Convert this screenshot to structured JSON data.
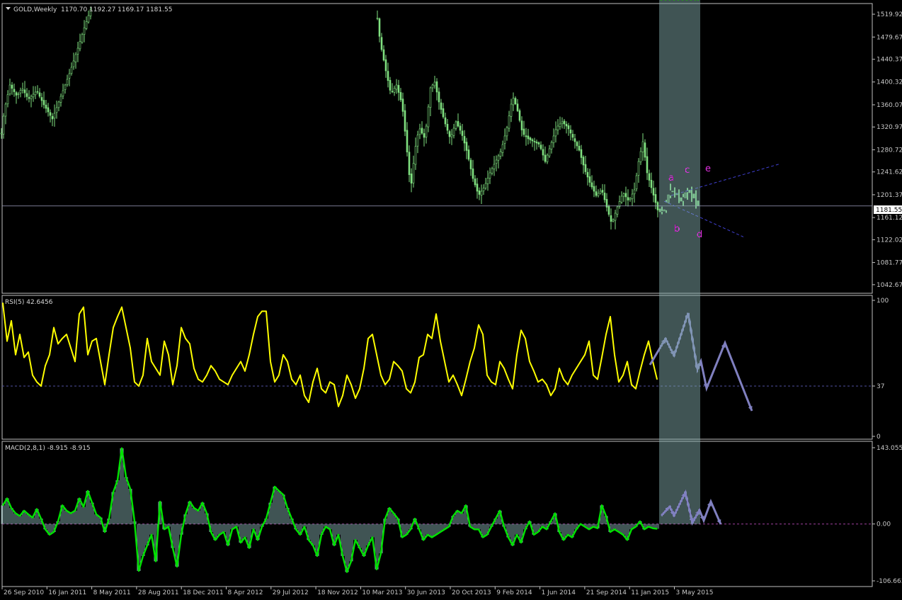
{
  "main_header": {
    "symbol": "GOLD,Weekly",
    "ohlc": "1170.70 1192.27 1169.17 1181.55"
  },
  "rsi_header": "RSI(5) 42.6456",
  "macd_header": "MACD(2,8,1) -8.915 -8.915",
  "current_price_tag": "1181.55",
  "wave_labels": [
    "a",
    "b",
    "c",
    "d",
    "e"
  ],
  "colors": {
    "background": "#000000",
    "frame": "#c0c0c0",
    "candle": "#7fe07f",
    "rsi_line": "#ffff00",
    "macd_line": "#00e000",
    "macd_hist": "#7fa7a7",
    "projection_arrows": "#8080c0",
    "trendline": "#4040d0",
    "wave_label": "#e030e0",
    "level_line": "#5050a0"
  },
  "chart_data": [
    {
      "type": "candlestick",
      "title": "GOLD,Weekly",
      "ylim": [
        1030,
        1535
      ],
      "y_ticks": [
        "1519.92",
        "1479.67",
        "1440.37",
        "1400.32",
        "1360.07",
        "1320.97",
        "1280.72",
        "1241.62",
        "1201.37",
        "1161.12",
        "1122.02",
        "1081.77",
        "1042.67"
      ],
      "x_ticks": [
        "26 Sep 2010",
        "16 Jan 2011",
        "8 May 2011",
        "28 Aug 2011",
        "18 Dec 2011",
        "8 Apr 2012",
        "29 Jul 2012",
        "18 Nov 2012",
        "10 Mar 2013",
        "30 Jun 2013",
        "20 Oct 2013",
        "9 Feb 2014",
        "1 Jun 2014",
        "21 Sep 2014",
        "11 Jan 2015",
        "3 May 2015"
      ],
      "price_line": 1181.55,
      "close_series": [
        [
          0,
          1290
        ],
        [
          6,
          1350
        ],
        [
          14,
          1395
        ],
        [
          24,
          1375
        ],
        [
          31,
          1390
        ],
        [
          40,
          1370
        ],
        [
          52,
          1385
        ],
        [
          62,
          1360
        ],
        [
          74,
          1335
        ],
        [
          86,
          1375
        ],
        [
          98,
          1415
        ],
        [
          110,
          1460
        ],
        [
          120,
          1500
        ],
        [
          130,
          1535
        ],
        [
          531,
          1535
        ],
        [
          537,
          1470
        ],
        [
          545,
          1420
        ],
        [
          552,
          1380
        ],
        [
          560,
          1395
        ],
        [
          568,
          1360
        ],
        [
          574,
          1290
        ],
        [
          580,
          1210
        ],
        [
          586,
          1280
        ],
        [
          592,
          1320
        ],
        [
          600,
          1300
        ],
        [
          608,
          1390
        ],
        [
          614,
          1400
        ],
        [
          620,
          1365
        ],
        [
          628,
          1330
        ],
        [
          636,
          1300
        ],
        [
          644,
          1330
        ],
        [
          652,
          1310
        ],
        [
          660,
          1275
        ],
        [
          668,
          1230
        ],
        [
          676,
          1200
        ],
        [
          684,
          1215
        ],
        [
          692,
          1240
        ],
        [
          700,
          1260
        ],
        [
          708,
          1280
        ],
        [
          716,
          1320
        ],
        [
          724,
          1375
        ],
        [
          730,
          1355
        ],
        [
          738,
          1310
        ],
        [
          746,
          1300
        ],
        [
          754,
          1295
        ],
        [
          762,
          1290
        ],
        [
          770,
          1260
        ],
        [
          778,
          1290
        ],
        [
          786,
          1320
        ],
        [
          794,
          1330
        ],
        [
          802,
          1320
        ],
        [
          810,
          1300
        ],
        [
          818,
          1280
        ],
        [
          826,
          1245
        ],
        [
          834,
          1220
        ],
        [
          842,
          1200
        ],
        [
          850,
          1210
        ],
        [
          858,
          1175
        ],
        [
          864,
          1150
        ],
        [
          872,
          1180
        ],
        [
          880,
          1205
        ],
        [
          888,
          1190
        ],
        [
          896,
          1210
        ],
        [
          902,
          1260
        ],
        [
          908,
          1295
        ],
        [
          914,
          1240
        ],
        [
          922,
          1205
        ],
        [
          930,
          1170
        ],
        [
          938,
          1175
        ],
        [
          946,
          1210
        ],
        [
          954,
          1205
        ],
        [
          962,
          1190
        ],
        [
          970,
          1210
        ],
        [
          978,
          1200
        ],
        [
          986,
          1182
        ]
      ]
    },
    {
      "type": "line",
      "title": "RSI(5) 42.6456",
      "ylim": [
        0,
        100
      ],
      "y_ticks": [
        "100",
        "37",
        "0"
      ],
      "level": 37,
      "x": [
        4,
        10,
        16,
        22,
        28,
        34,
        40,
        46,
        52,
        58,
        64,
        70,
        76,
        82,
        88,
        94,
        100,
        106,
        112,
        118,
        124,
        130,
        136,
        142,
        148,
        154,
        160,
        166,
        172,
        178,
        184,
        190,
        196,
        202,
        208,
        214,
        220,
        226,
        232,
        238,
        244,
        250,
        256,
        262,
        268,
        274,
        280,
        286,
        292,
        298,
        304,
        310,
        316,
        322,
        328,
        334,
        340,
        346,
        352,
        358,
        364,
        370,
        376,
        382,
        388,
        394,
        400,
        406,
        412,
        418,
        424,
        430,
        436,
        442,
        448,
        454,
        460,
        466,
        472,
        478,
        484,
        490,
        496,
        502,
        508,
        514,
        520,
        526,
        532,
        538,
        544,
        550,
        556,
        562,
        568,
        574,
        580,
        586,
        592,
        598,
        604,
        610,
        616,
        622,
        628,
        634,
        640,
        646,
        652,
        658,
        664,
        670,
        676,
        682,
        688,
        694,
        700,
        706,
        712,
        718,
        724,
        730,
        736,
        742,
        748,
        754,
        760,
        766,
        772,
        778,
        784,
        790,
        796,
        802,
        808,
        814,
        820,
        826,
        832,
        838,
        844,
        850,
        856,
        862,
        868,
        874,
        880,
        886,
        892,
        898,
        904,
        910,
        916,
        922,
        928,
        934,
        940,
        946,
        952,
        958,
        964,
        970,
        976,
        982,
        986
      ],
      "values": [
        98,
        70,
        85,
        60,
        75,
        58,
        62,
        45,
        40,
        37,
        52,
        60,
        80,
        68,
        72,
        75,
        65,
        55,
        90,
        95,
        60,
        70,
        72,
        55,
        38,
        60,
        80,
        88,
        95,
        80,
        65,
        40,
        37,
        45,
        72,
        55,
        50,
        45,
        70,
        60,
        38,
        52,
        80,
        72,
        68,
        50,
        42,
        40,
        45,
        52,
        48,
        42,
        40,
        38,
        45,
        50,
        55,
        48,
        60,
        75,
        88,
        92,
        92,
        55,
        40,
        45,
        60,
        55,
        42,
        38,
        45,
        30,
        25,
        40,
        50,
        35,
        32,
        40,
        38,
        22,
        30,
        45,
        38,
        28,
        35,
        50,
        72,
        75,
        60,
        45,
        38,
        42,
        55,
        52,
        48,
        35,
        32,
        40,
        58,
        60,
        75,
        72,
        90,
        70,
        55,
        40,
        45,
        38,
        30,
        42,
        55,
        65,
        82,
        75,
        45,
        40,
        38,
        55,
        50,
        42,
        35,
        60,
        78,
        72,
        55,
        48,
        40,
        42,
        38,
        30,
        35,
        50,
        42,
        38,
        45,
        50,
        55,
        60,
        70,
        45,
        42,
        58,
        75,
        88,
        60,
        40,
        45,
        55,
        38,
        35,
        48,
        60,
        70,
        55,
        42
      ],
      "projection": [
        [
          918,
          515
        ],
        [
          940,
          478
        ],
        [
          952,
          502
        ],
        [
          972,
          442
        ],
        [
          985,
          522
        ],
        [
          990,
          510
        ],
        [
          998,
          548
        ],
        [
          1024,
          484
        ],
        [
          1062,
          580
        ]
      ]
    },
    {
      "type": "line",
      "title": "MACD(2,8,1) -8.915 -8.915",
      "ylim": [
        -106.663,
        143.055
      ],
      "y_ticks": [
        "143.055",
        "0.00",
        "-106.663"
      ],
      "level": 0,
      "x": [
        4,
        10,
        16,
        22,
        28,
        34,
        40,
        46,
        52,
        58,
        64,
        70,
        76,
        82,
        88,
        94,
        100,
        106,
        112,
        118,
        124,
        130,
        136,
        142,
        148,
        154,
        160,
        166,
        172,
        178,
        184,
        190,
        196,
        202,
        208,
        214,
        220,
        226,
        232,
        238,
        244,
        250,
        256,
        262,
        268,
        274,
        280,
        286,
        292,
        298,
        304,
        310,
        316,
        322,
        328,
        334,
        340,
        346,
        352,
        358,
        364,
        370,
        376,
        382,
        388,
        394,
        400,
        406,
        412,
        418,
        424,
        430,
        436,
        442,
        448,
        454,
        460,
        466,
        472,
        478,
        484,
        490,
        496,
        502,
        508,
        514,
        520,
        526,
        532,
        538,
        544,
        550,
        556,
        562,
        568,
        574,
        580,
        586,
        592,
        598,
        604,
        610,
        616,
        622,
        628,
        634,
        640,
        646,
        652,
        658,
        664,
        670,
        676,
        682,
        688,
        694,
        700,
        706,
        712,
        718,
        724,
        730,
        736,
        742,
        748,
        754,
        760,
        766,
        772,
        778,
        784,
        790,
        796,
        802,
        808,
        814,
        820,
        826,
        832,
        838,
        844,
        850,
        856,
        862,
        868,
        874,
        880,
        886,
        892,
        898,
        904,
        910,
        916,
        922,
        928,
        934,
        940,
        946,
        952,
        958,
        964,
        970,
        976,
        982,
        986
      ],
      "values": [
        35,
        48,
        30,
        20,
        15,
        25,
        18,
        12,
        28,
        10,
        -10,
        -20,
        -15,
        5,
        35,
        25,
        20,
        25,
        48,
        32,
        62,
        40,
        18,
        12,
        -15,
        10,
        60,
        82,
        142,
        88,
        66,
        5,
        -88,
        -60,
        -40,
        -20,
        -70,
        42,
        -10,
        -5,
        -45,
        -80,
        -20,
        18,
        42,
        30,
        25,
        40,
        20,
        -15,
        -30,
        -20,
        -15,
        -40,
        -10,
        -5,
        -35,
        -25,
        -45,
        -10,
        -30,
        -5,
        10,
        40,
        70,
        62,
        55,
        30,
        10,
        -10,
        -20,
        -5,
        -30,
        -40,
        -60,
        -20,
        -5,
        -10,
        -40,
        -20,
        -60,
        -90,
        -70,
        -30,
        -45,
        -60,
        -40,
        -25,
        -85,
        -55,
        10,
        30,
        20,
        10,
        -25,
        -20,
        -10,
        10,
        -10,
        -30,
        -20,
        -25,
        -20,
        -15,
        -10,
        -5,
        15,
        25,
        20,
        35,
        -5,
        -10,
        -10,
        -25,
        -20,
        -5,
        10,
        25,
        -5,
        -25,
        -40,
        -20,
        -35,
        -10,
        5,
        -20,
        -15,
        -5,
        -10,
        5,
        20,
        -15,
        -30,
        -20,
        -25,
        -10,
        0,
        -5,
        -10,
        -5,
        -8,
        35,
        15,
        -15,
        -10,
        -15,
        -20,
        -30,
        -10,
        -5,
        5,
        -10,
        -5,
        -8,
        -9
      ],
      "projection": [
        [
          934,
          728
        ],
        [
          946,
          715
        ],
        [
          952,
          728
        ],
        [
          968,
          695
        ],
        [
          978,
          738
        ],
        [
          988,
          720
        ],
        [
          994,
          735
        ],
        [
          1004,
          708
        ],
        [
          1018,
          740
        ]
      ]
    }
  ]
}
